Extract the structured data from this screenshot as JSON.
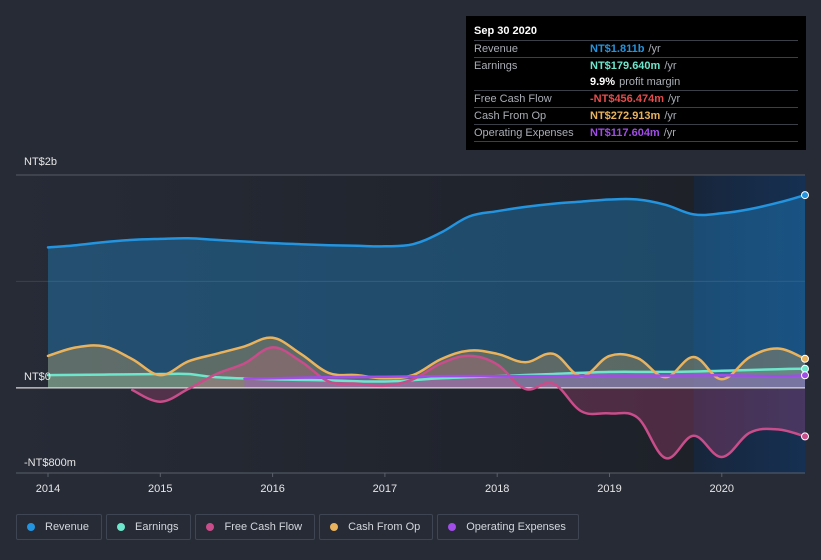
{
  "tooltip": {
    "date": "Sep 30 2020",
    "rows": [
      {
        "label": "Revenue",
        "value": "NT$1.811b",
        "unit": "/yr",
        "color": "#2394df"
      },
      {
        "label": "Earnings",
        "value": "NT$179.640m",
        "unit": "/yr",
        "color": "#6ee6cc"
      },
      {
        "label": "",
        "value": "9.9%",
        "unit": "profit margin",
        "color": "#ffffff"
      },
      {
        "label": "Free Cash Flow",
        "value": "-NT$456.474m",
        "unit": "/yr",
        "color": "#e74c4c"
      },
      {
        "label": "Cash From Op",
        "value": "NT$272.913m",
        "unit": "/yr",
        "color": "#e9b35e"
      },
      {
        "label": "Operating Expenses",
        "value": "NT$117.604m",
        "unit": "/yr",
        "color": "#a14de8"
      }
    ]
  },
  "legend": [
    {
      "label": "Revenue",
      "color": "#2394df"
    },
    {
      "label": "Earnings",
      "color": "#6ee6cc"
    },
    {
      "label": "Free Cash Flow",
      "color": "#c94d8a"
    },
    {
      "label": "Cash From Op",
      "color": "#e9b35e"
    },
    {
      "label": "Operating Expenses",
      "color": "#a14de8"
    }
  ],
  "chart_data": {
    "type": "area",
    "title": "",
    "xlabel": "",
    "ylabel": "",
    "currency": "NT$",
    "y_tick_labels": [
      "NT$2b",
      "NT$0",
      "-NT$800m"
    ],
    "y_ticks": [
      2000,
      0,
      -800
    ],
    "ylim": [
      -800,
      2000
    ],
    "x_tick_labels": [
      "2014",
      "2015",
      "2016",
      "2017",
      "2018",
      "2019",
      "2020"
    ],
    "x_ticks": [
      2014,
      2015,
      2016,
      2017,
      2018,
      2019,
      2020
    ],
    "xlim": [
      2013.7,
      2020.75
    ],
    "forecast_shade_start": 2019.75,
    "grid": true,
    "legend_position": "bottom-left",
    "series": [
      {
        "name": "Revenue",
        "color": "#2394df",
        "x": [
          2014.0,
          2014.25,
          2014.5,
          2014.75,
          2015.0,
          2015.25,
          2015.5,
          2015.75,
          2016.0,
          2016.25,
          2016.5,
          2016.75,
          2017.0,
          2017.25,
          2017.5,
          2017.75,
          2018.0,
          2018.25,
          2018.5,
          2018.75,
          2019.0,
          2019.25,
          2019.5,
          2019.75,
          2020.0,
          2020.25,
          2020.5,
          2020.75
        ],
        "values": [
          1320,
          1340,
          1370,
          1390,
          1400,
          1405,
          1390,
          1375,
          1360,
          1350,
          1340,
          1335,
          1330,
          1350,
          1460,
          1610,
          1660,
          1700,
          1730,
          1750,
          1770,
          1770,
          1720,
          1630,
          1640,
          1680,
          1740,
          1811
        ]
      },
      {
        "name": "Earnings",
        "color": "#6ee6cc",
        "x": [
          2014.0,
          2014.5,
          2015.0,
          2015.25,
          2015.5,
          2016.0,
          2016.5,
          2017.0,
          2017.5,
          2018.0,
          2018.5,
          2019.0,
          2019.5,
          2020.0,
          2020.5,
          2020.75
        ],
        "values": [
          120,
          125,
          130,
          130,
          100,
          80,
          70,
          60,
          90,
          110,
          130,
          150,
          150,
          160,
          175,
          180
        ]
      },
      {
        "name": "Free Cash Flow",
        "color": "#c94d8a",
        "x": [
          2014.75,
          2015.0,
          2015.25,
          2015.5,
          2015.75,
          2016.0,
          2016.25,
          2016.5,
          2016.75,
          2017.0,
          2017.25,
          2017.5,
          2017.75,
          2018.0,
          2018.25,
          2018.5,
          2018.75,
          2019.0,
          2019.25,
          2019.5,
          2019.75,
          2020.0,
          2020.25,
          2020.5,
          2020.75
        ],
        "values": [
          -20,
          -130,
          -10,
          130,
          230,
          380,
          250,
          60,
          40,
          20,
          80,
          230,
          300,
          220,
          -10,
          40,
          -220,
          -240,
          -280,
          -660,
          -450,
          -650,
          -420,
          -390,
          -456
        ]
      },
      {
        "name": "Cash From Op",
        "color": "#e9b35e",
        "x": [
          2014.0,
          2014.25,
          2014.5,
          2014.75,
          2015.0,
          2015.25,
          2015.5,
          2015.75,
          2016.0,
          2016.25,
          2016.5,
          2016.75,
          2017.0,
          2017.25,
          2017.5,
          2017.75,
          2018.0,
          2018.25,
          2018.5,
          2018.75,
          2019.0,
          2019.25,
          2019.5,
          2019.75,
          2020.0,
          2020.25,
          2020.5,
          2020.75
        ],
        "values": [
          300,
          380,
          390,
          270,
          120,
          250,
          320,
          390,
          470,
          320,
          140,
          120,
          90,
          120,
          270,
          350,
          320,
          240,
          320,
          110,
          300,
          280,
          100,
          290,
          80,
          290,
          370,
          273
        ]
      },
      {
        "name": "Operating Expenses",
        "color": "#a14de8",
        "x": [
          2015.75,
          2016.0,
          2016.5,
          2017.0,
          2017.5,
          2018.0,
          2018.5,
          2019.0,
          2019.5,
          2020.0,
          2020.5,
          2020.75
        ],
        "values": [
          85,
          90,
          100,
          105,
          110,
          110,
          110,
          115,
          115,
          118,
          110,
          118
        ]
      }
    ]
  }
}
